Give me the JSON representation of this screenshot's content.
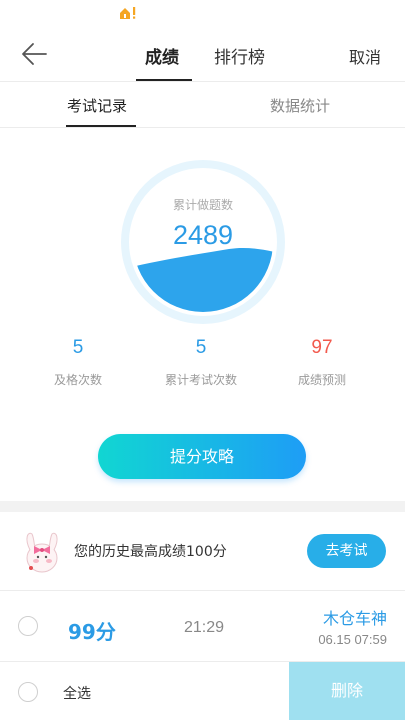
{
  "header": {
    "tabs": [
      {
        "label": "成绩",
        "active": true
      },
      {
        "label": "排行榜",
        "active": false
      }
    ],
    "cancel_label": "取消"
  },
  "sub_tabs": [
    {
      "label": "考试记录",
      "active": true
    },
    {
      "label": "数据统计",
      "active": false
    }
  ],
  "summary": {
    "gauge_label": "累计做题数",
    "gauge_value": "2489",
    "stats": [
      {
        "value": "5",
        "label": "及格次数"
      },
      {
        "value": "5",
        "label": "累计考试次数"
      },
      {
        "value": "97",
        "label": "成绩预测"
      }
    ],
    "strategy_button": "提分攻略"
  },
  "best": {
    "text": "您的历史最高成绩100分",
    "go_exam_button": "去考试"
  },
  "records": [
    {
      "score": "99分",
      "duration": "21:29",
      "name": "木仓车神",
      "date": "06.15  07:59"
    }
  ],
  "footer": {
    "select_all": "全选",
    "delete": "删除"
  },
  "colors": {
    "accent": "#2b9be5",
    "prediction": "#f25a4e",
    "button_gradient_start": "#11d6d2",
    "button_gradient_end": "#1e9df6",
    "delete_disabled": "#9fe0f0",
    "warning": "#f5a623"
  }
}
